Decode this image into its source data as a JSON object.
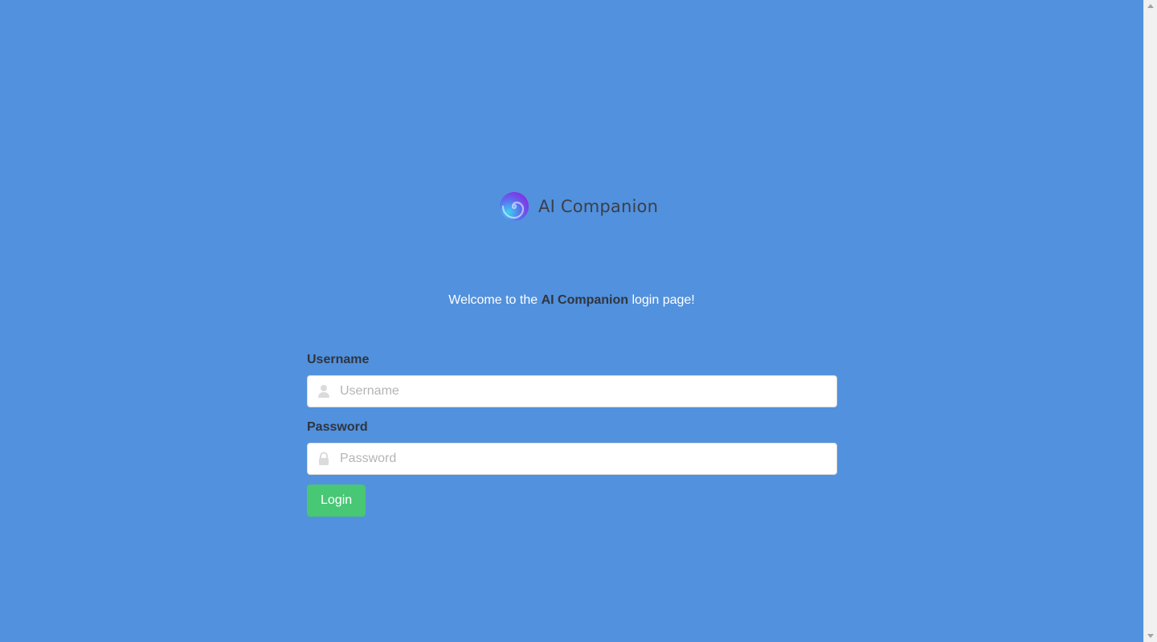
{
  "brand": {
    "name": "AI Companion"
  },
  "welcome": {
    "prefix": "Welcome to the ",
    "highlight": "AI Companion",
    "suffix": " login page!"
  },
  "form": {
    "username": {
      "label": "Username",
      "placeholder": "Username",
      "value": "",
      "icon": "user-icon"
    },
    "password": {
      "label": "Password",
      "placeholder": "Password",
      "value": "",
      "icon": "lock-icon"
    },
    "submit_label": "Login"
  },
  "colors": {
    "background": "#5291dd",
    "button": "#48c774",
    "text_dark": "#2f3540"
  }
}
